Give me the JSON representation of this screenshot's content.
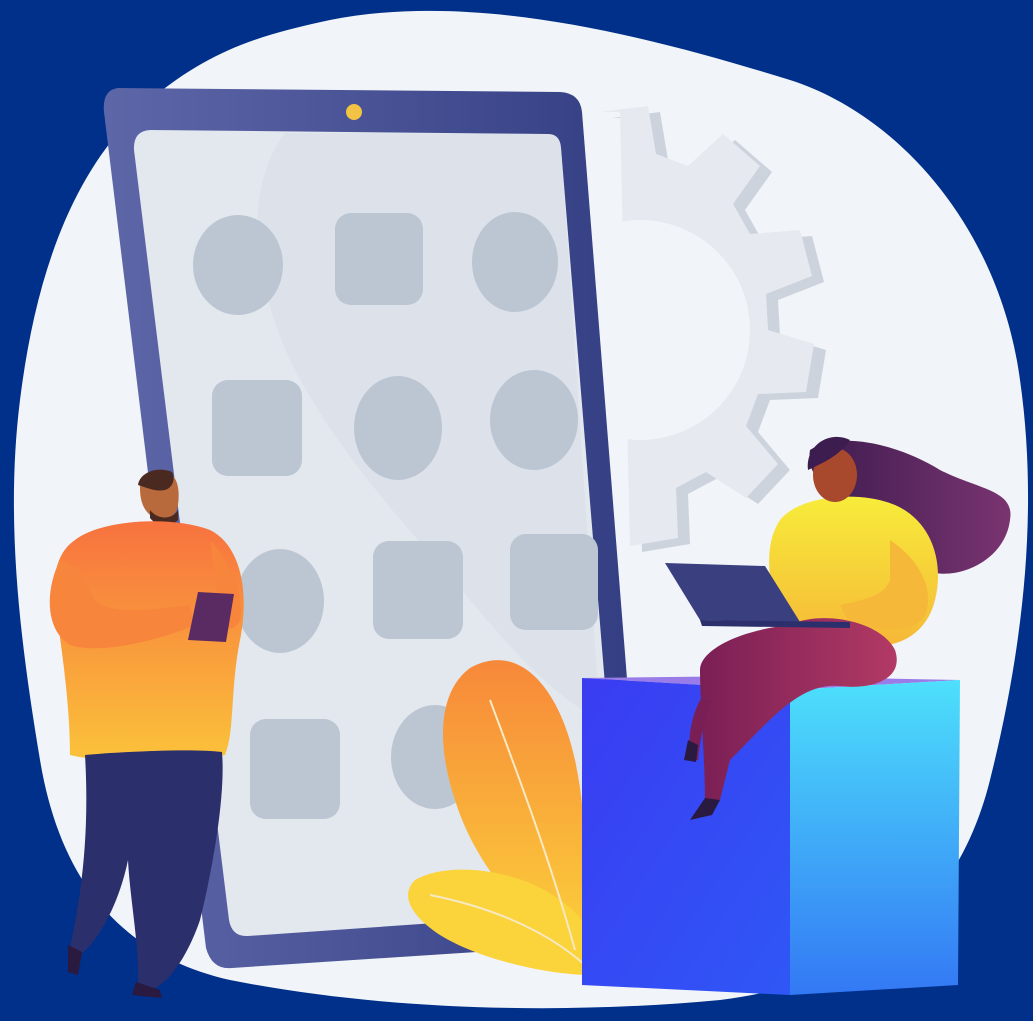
{
  "colors": {
    "background": "#00308a",
    "blob": "#f1f4f8",
    "phone_frame": "#3e4a8e",
    "phone_screen": "#e3e7ee",
    "app_icon": "#bcc6d3",
    "camera_dot": "#f3c343",
    "gear": "#e6eaf0",
    "gear_shadow": "#cdd3dd",
    "cube_front": "#3346f5",
    "cube_side": "#36a9f7",
    "cube_top": "#9a7ce8",
    "man_shirt": "#f78a3b",
    "man_pants": "#2b2f6b",
    "woman_shirt": "#f5e637",
    "woman_pants": "#a0295b",
    "woman_hair": "#5a2a62",
    "laptop": "#3a3f80",
    "plant": "#f79a3a"
  },
  "scene": {
    "elements": [
      "background-blob",
      "gear-icon",
      "smartphone",
      "app-icon-grid",
      "man-with-tablet",
      "woman-with-laptop",
      "plant-leaves",
      "cube-seat"
    ]
  }
}
